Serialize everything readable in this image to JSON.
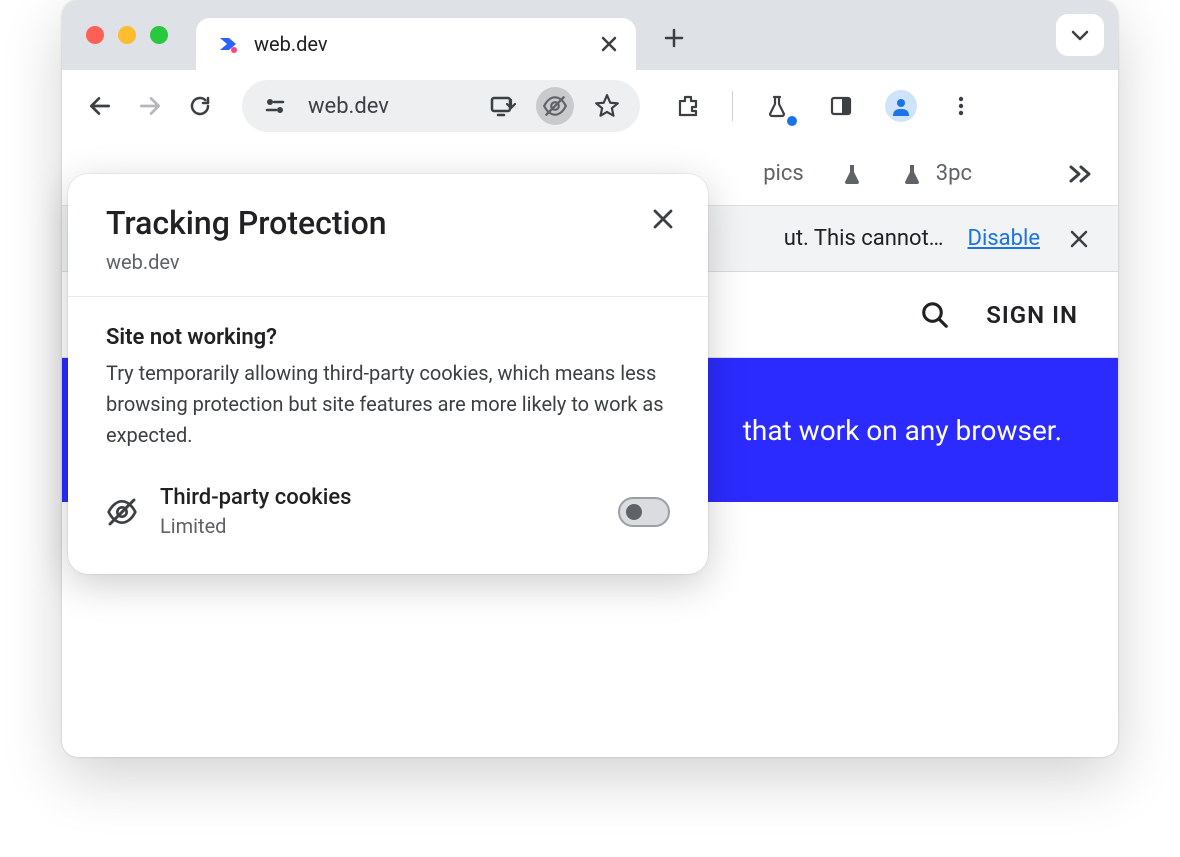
{
  "tab": {
    "title": "web.dev"
  },
  "omnibox": {
    "url": "web.dev"
  },
  "bookmarks": {
    "item_topics": "pics",
    "item_3pc": "3pc"
  },
  "infobar": {
    "text": "ut. This cannot…",
    "link_label": "Disable"
  },
  "page_header": {
    "signin_label": "SIGN IN"
  },
  "banner": {
    "text": "that work on any browser."
  },
  "popover": {
    "title": "Tracking Protection",
    "site": "web.dev",
    "section_heading": "Site not working?",
    "section_body": "Try temporarily allowing third-party cookies, which means less browsing protection but site features are more likely to work as expected.",
    "cookie_label": "Third-party cookies",
    "cookie_status": "Limited"
  }
}
